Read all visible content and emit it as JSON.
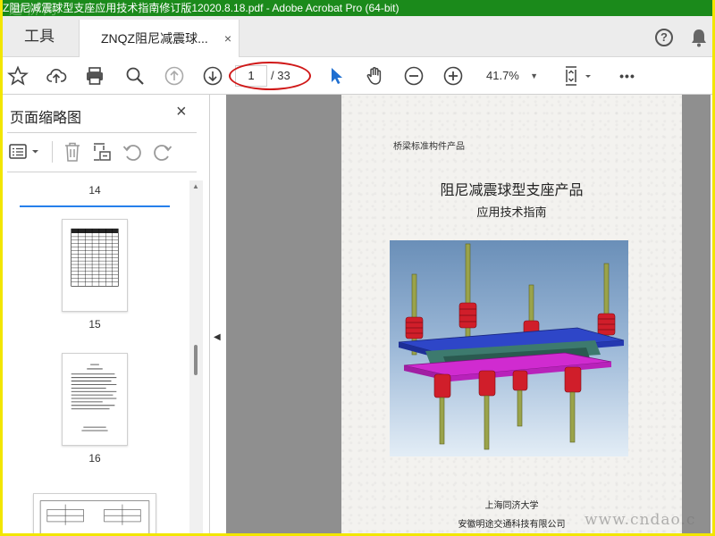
{
  "window": {
    "title": "Z阻尼减震球型支座应用技术指南修订版12020.8.18.pdf - Adobe Acrobat Pro (64-bit)",
    "watermark_top": "道桥网",
    "watermark_bottom": "www.cndao.c"
  },
  "tabs": {
    "tools_label": "工具",
    "doc_label": "ZNQZ阻尼减震球...",
    "close_glyph": "×"
  },
  "toolbar": {
    "current_page": "1",
    "total_pages": "/ 33",
    "zoom": "41.7%",
    "help_glyph": "?",
    "more_glyph": "•••"
  },
  "sidebar": {
    "title": "页面缩略图",
    "close_glyph": "×",
    "thumbnails": [
      {
        "label": "14"
      },
      {
        "label": "15"
      },
      {
        "label": "16"
      }
    ]
  },
  "page": {
    "header": "桥梁标准构件产品",
    "title": "阻尼减震球型支座产品",
    "subtitle": "应用技术指南",
    "org1": "上海同济大学",
    "org2": "安徽明途交通科技有限公司"
  },
  "colors": {
    "titlebar": "#1b8a1b",
    "accent": "#2680eb",
    "highlight_ellipse": "#d01818",
    "frame": "#f2e600"
  }
}
